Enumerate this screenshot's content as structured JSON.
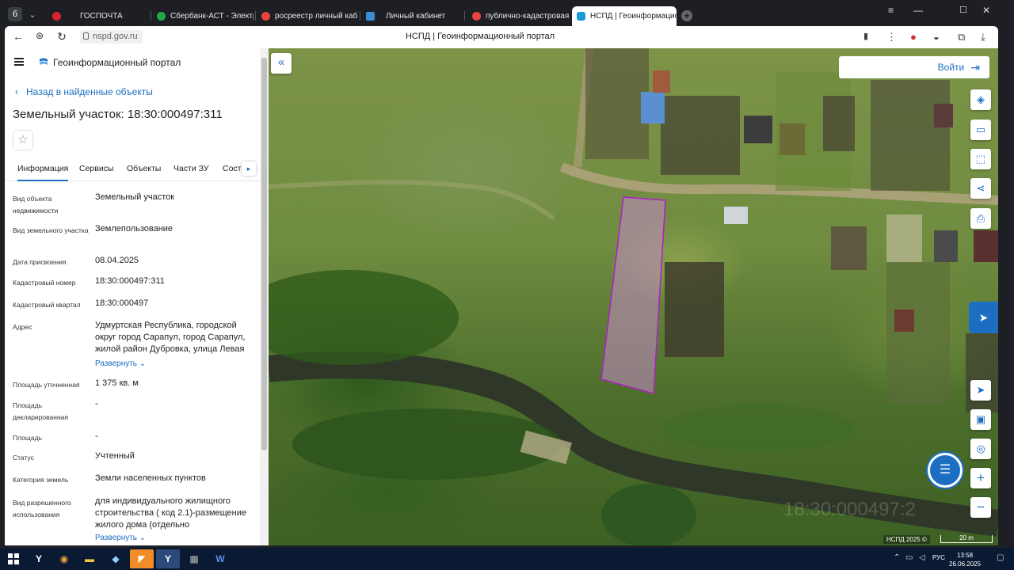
{
  "browser": {
    "tabs": [
      {
        "label": "ГОСПОЧТА",
        "fav_color": "#d9242f"
      },
      {
        "label": "Сбербанк-АСТ - Электро",
        "fav_color": "#22a84b"
      },
      {
        "label": "росреестр личный кабин",
        "fav_color": "#e8453c"
      },
      {
        "label": "Личный кабинет",
        "fav_color": "#3a8fd8"
      },
      {
        "label": "публично-кадастровая к",
        "fav_color": "#e8453c"
      },
      {
        "label": "НСПД | Геоинформацио",
        "fav_color": "#1b9ad6"
      }
    ],
    "url": "nspd.gov.ru",
    "page_title": "НСПД | Геоинформационный портал"
  },
  "panel": {
    "portal_title": "Геоинформационный портал",
    "back_label": "Назад в найденные объекты",
    "object_title": "Земельный участок: 18:30:000497:311",
    "tabs": [
      "Информация",
      "Сервисы",
      "Объекты",
      "Части ЗУ",
      "Соста"
    ],
    "expand_label": "Развернуть",
    "rows": [
      {
        "k": "Вид объекта недвижимости",
        "v": "Земельный участок"
      },
      {
        "k": "Вид земельного участка",
        "v": "Землепользование"
      },
      {
        "k": "Дата присвоения",
        "v": "08.04.2025"
      },
      {
        "k": "Кадастровый номер",
        "v": "18:30:000497:311"
      },
      {
        "k": "Кадастровый квартал",
        "v": "18:30:000497"
      },
      {
        "k": "Адрес",
        "v": "Удмуртская Республика, городской округ город Сарапул, город Сарапул, жилой район Дубровка, улица Левая"
      },
      {
        "k": "Площадь уточненная",
        "v": "1 375 кв. м"
      },
      {
        "k": "Площадь декларированная",
        "v": "-"
      },
      {
        "k": "Площадь",
        "v": "-"
      },
      {
        "k": "Статус",
        "v": "Учтенный"
      },
      {
        "k": "Категория земель",
        "v": "Земли населенных пунктов"
      },
      {
        "k": "Вид разрешенного использования",
        "v": "для индивидуального жилищного строительства ( код 2.1)-размещение жилого дома (отдельно"
      }
    ]
  },
  "map": {
    "login_label": "Войти",
    "attribution": "НСПД 2025 ©",
    "scale_label": "20 m",
    "watermark": "18:30:000497:2"
  },
  "taskbar": {
    "lang": "РУС",
    "time": "13:58",
    "date": "26.06.2025"
  },
  "colors": {
    "accent": "#1b6ec2",
    "parcel_outline": "#b01ec8"
  }
}
